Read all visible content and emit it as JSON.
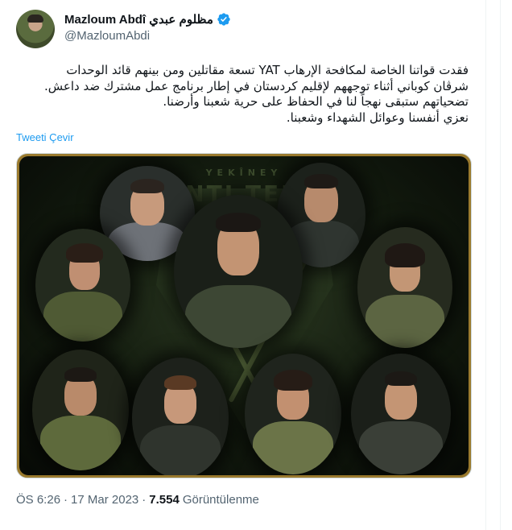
{
  "author": {
    "display_name": "Mazloum Abdî مظلوم عبدي",
    "handle": "@MazloumAbdi",
    "verified": true
  },
  "tweet": {
    "lines": [
      "فقدت قواتنا الخاصة لمكافحة الإرهاب YAT تسعة مقاتلين ومن بينهم قائد الوحدات",
      "شرڤان كوباني أثناء توجههم لإقليم كردستان في إطار برنامج عمل مشترك ضد داعش.",
      "تضحياتهم ستبقى نهجاً لنا في الحفاظ على حرية شعبنا وأرضنا.",
      "نعزي أنفسنا وعوائل الشهداء وشعبنا."
    ],
    "translate_label": "Tweeti Çevir"
  },
  "media": {
    "emblem_top": "YEKÎNEY",
    "emblem_main": "ANTI TERO"
  },
  "meta": {
    "time": "ÖS 6:26",
    "sep1": "·",
    "date": "17 Mar 2023",
    "sep2": "·",
    "views_count": "7.554",
    "views_label": "Görüntülenme"
  },
  "colors": {
    "link": "#1d9bf0",
    "muted": "#536471",
    "text": "#0f1419",
    "frame": "#9a7a2e"
  }
}
